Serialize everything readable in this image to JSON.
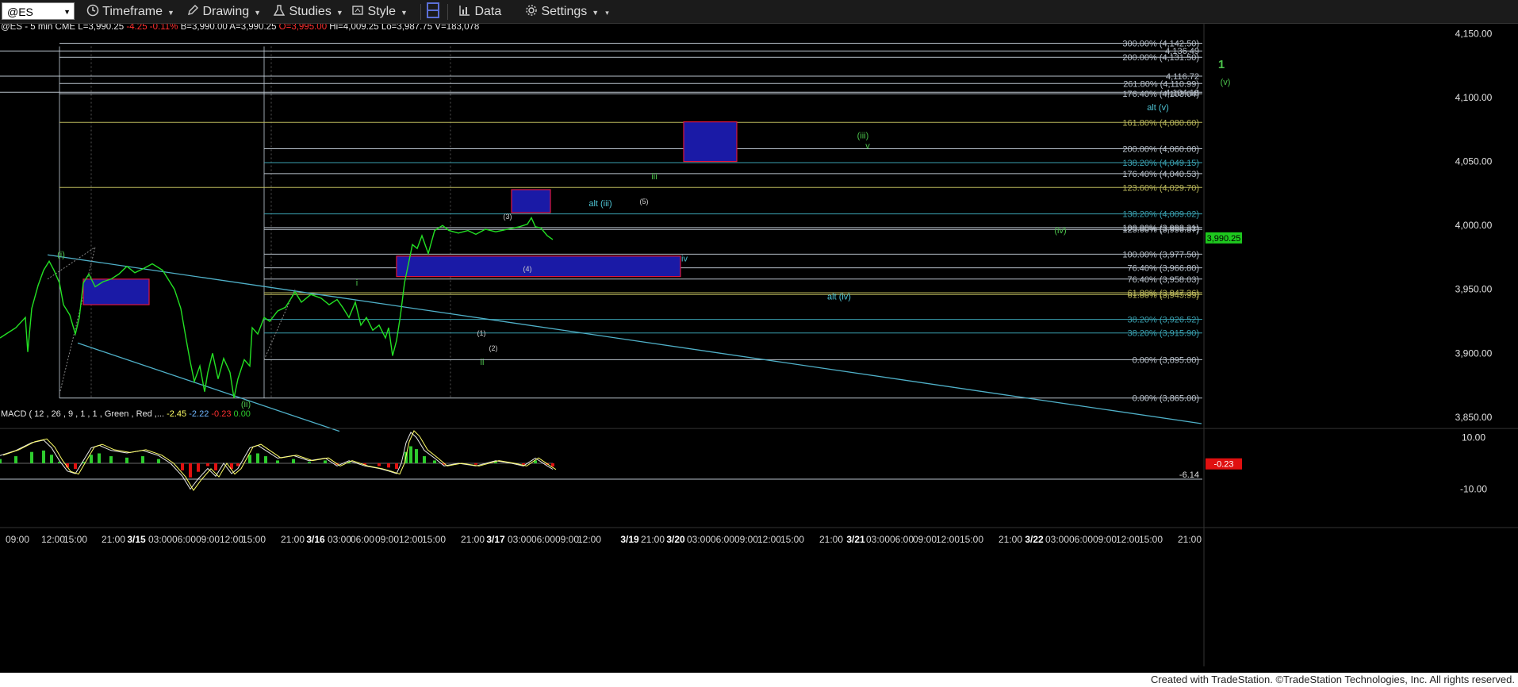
{
  "toolbar": {
    "symbol": "@ES",
    "items": [
      {
        "label": "Timeframe",
        "icon": "clock-icon"
      },
      {
        "label": "Drawing",
        "icon": "pencil-icon"
      },
      {
        "label": "Studies",
        "icon": "flask-icon"
      },
      {
        "label": "Style",
        "icon": "style-icon"
      },
      {
        "label": "",
        "icon": "layout-icon"
      },
      {
        "label": "Data",
        "icon": "bars-icon"
      },
      {
        "label": "Settings",
        "icon": "gear-icon"
      }
    ]
  },
  "quote": {
    "symbol_interval": "@ES - 5 min  CME",
    "last": "L=3,990.25",
    "change": "-4.25",
    "pct": "-0.11%",
    "bid": "B=3,990.00",
    "ask": "A=3,990.25",
    "open": "O=3,995.00",
    "high": "Hi=4,009.25",
    "low": "Lo=3,987.75",
    "volume": "V=183,078"
  },
  "price_axis": [
    {
      "v": 4150,
      "label": "4,150.00"
    },
    {
      "v": 4100,
      "label": "4,100.00"
    },
    {
      "v": 4050,
      "label": "4,050.00"
    },
    {
      "v": 4000,
      "label": "4,000.00"
    },
    {
      "v": 3950,
      "label": "3,950.00"
    },
    {
      "v": 3900,
      "label": "3,900.00"
    },
    {
      "v": 3850,
      "label": "3,850.00"
    }
  ],
  "last_price_tag": "3,990.25",
  "fib_levels": [
    {
      "v": 4142.5,
      "label": "300.00% (4,142.50)",
      "color": "#b9c2cc"
    },
    {
      "v": 4136.49,
      "label": "4,136.49",
      "color": "#b9c2cc"
    },
    {
      "v": 4131.5,
      "label": "200.00% (4,131.50)",
      "color": "#b9c2cc"
    },
    {
      "v": 4116.72,
      "label": "4,116.72",
      "color": "#b9c2cc"
    },
    {
      "v": 4110.99,
      "label": "261.80% (4,110.99)",
      "color": "#b9c2cc"
    },
    {
      "v": 4104.18,
      "label": "4,104.18",
      "color": "#b9c2cc"
    },
    {
      "v": 4103.04,
      "label": "176.40% (4,103.04)",
      "color": "#b9c2cc"
    },
    {
      "v": 4080.6,
      "label": "161.80% (4,080.60)",
      "color": "#b8b55a"
    },
    {
      "v": 4060.0,
      "label": "200.00% (4,060.00)",
      "color": "#b9c2cc"
    },
    {
      "v": 4049.15,
      "label": "138.20% (4,049.15)",
      "color": "#3aa0b0"
    },
    {
      "v": 4040.53,
      "label": "176.40% (4,040.53)",
      "color": "#b9c2cc"
    },
    {
      "v": 4029.7,
      "label": "123.60% (4,029.70)",
      "color": "#b8b55a"
    },
    {
      "v": 4009.02,
      "label": "138.20% (4,009.02)",
      "color": "#3aa0b0"
    },
    {
      "v": 3998.31,
      "label": "100.00% (3,998.31)",
      "color": "#b9c2cc"
    },
    {
      "v": 3996.87,
      "label": "123.60% (3,996.87)",
      "color": "#b9c2cc"
    },
    {
      "v": 3977.5,
      "label": "100.00% (3,977.50)",
      "color": "#b9c2cc"
    },
    {
      "v": 3966.8,
      "label": "76.40% (3,966.80)",
      "color": "#b9c2cc"
    },
    {
      "v": 3958.03,
      "label": "76.40% (3,958.03)",
      "color": "#b9c2cc"
    },
    {
      "v": 3947.36,
      "label": "61.80% (3,947.36)",
      "color": "#b8b55a"
    },
    {
      "v": 3945.95,
      "label": "61.80% (3,945.95)",
      "color": "#b8b55a"
    },
    {
      "v": 3926.52,
      "label": "38.20% (3,926.52)",
      "color": "#3aa0b0"
    },
    {
      "v": 3915.9,
      "label": "38.20% (3,915.90)",
      "color": "#3aa0b0"
    },
    {
      "v": 3895.0,
      "label": "0.00% (3,895.00)",
      "color": "#b9c2cc"
    },
    {
      "v": 3865.0,
      "label": "0.00% (3,865.00)",
      "color": "#b9c2cc"
    }
  ],
  "wave_labels": [
    {
      "t": "(i)",
      "color": "#4cc34c",
      "at": [
        77,
        3975
      ]
    },
    {
      "t": "(ii)",
      "color": "#4cc34c",
      "at": [
        310,
        3858
      ]
    },
    {
      "t": "i",
      "color": "#4cc34c",
      "at": [
        450,
        3953
      ]
    },
    {
      "t": "ii",
      "color": "#4cc34c",
      "at": [
        608,
        3891
      ]
    },
    {
      "t": "(1)",
      "color": "#cfcfcf",
      "at": [
        607,
        3914
      ]
    },
    {
      "t": "(2)",
      "color": "#cfcfcf",
      "at": [
        622,
        3902
      ]
    },
    {
      "t": "(3)",
      "color": "#cfcfcf",
      "at": [
        640,
        4005
      ]
    },
    {
      "t": "(4)",
      "color": "#cfcfcf",
      "at": [
        665,
        3964
      ]
    },
    {
      "t": "(5)",
      "color": "#cfcfcf",
      "at": [
        812,
        4017
      ]
    },
    {
      "t": "alt (iii)",
      "color": "#4ec4d4",
      "at": [
        757,
        4015
      ]
    },
    {
      "t": "iii",
      "color": "#4cc34c",
      "at": [
        825,
        4036
      ]
    },
    {
      "t": "iv",
      "color": "#4ec4d4",
      "at": [
        863,
        3972
      ]
    },
    {
      "t": "(iii)",
      "color": "#4cc34c",
      "at": [
        1088,
        4068
      ]
    },
    {
      "t": "v",
      "color": "#4cc34c",
      "at": [
        1094,
        4060
      ]
    },
    {
      "t": "alt (iv)",
      "color": "#4ec4d4",
      "at": [
        1058,
        3942
      ]
    },
    {
      "t": "(iv)",
      "color": "#4cc34c",
      "at": [
        1337,
        3994
      ]
    },
    {
      "t": "alt (v)",
      "color": "#4ec4d4",
      "at": [
        1460,
        4090
      ]
    },
    {
      "t": "1",
      "color": "#4cc34c",
      "at": [
        1540,
        4123
      ]
    },
    {
      "t": "(v)",
      "color": "#4cc34c",
      "at": [
        1545,
        4110
      ]
    }
  ],
  "macd": {
    "title": "MACD ( 12 , 26 , 9 , 1 , 1 , Green , Red ,...",
    "v1": "-2.45",
    "v2": "-2.22",
    "v3": "-0.23",
    "v4": "0.00",
    "axis": [
      {
        "v": 10,
        "label": "10.00"
      },
      {
        "v": -10,
        "label": "-10.00"
      }
    ],
    "tag_value": "-0.23",
    "ref_level_label": "-6.14",
    "colors": {
      "macd": "#ffff66",
      "signal": "#e8e8e8",
      "hist_pos": "#2ecc2e",
      "hist_neg": "#e01010"
    }
  },
  "time_axis": [
    "09:00",
    "12:00",
    "15:00",
    "21:00",
    "3/15",
    "03:00",
    "06:00",
    "09:00",
    "12:00",
    "15:00",
    "21:00",
    "3/16",
    "03:00",
    "06:00",
    "09:00",
    "12:00",
    "15:00",
    "21:00",
    "3/17",
    "03:00",
    "06:00",
    "09:00",
    "12:00",
    "3/19",
    "21:00",
    "3/20",
    "03:00",
    "06:00",
    "09:00",
    "12:00",
    "15:00",
    "21:00",
    "3/21",
    "03:00",
    "06:00",
    "09:00",
    "12:00",
    "15:00",
    "21:00",
    "3/22",
    "03:00",
    "06:00",
    "09:00",
    "12:00",
    "15:00",
    "21:00"
  ],
  "footer": "Created with TradeStation. ©TradeStation Technologies, Inc. All rights reserved.",
  "colors": {
    "price": "#23e023",
    "box_fill": "#1a1aa6",
    "box_border": "#e0163c",
    "trend": "#4fb0c8",
    "bg": "#000000"
  }
}
